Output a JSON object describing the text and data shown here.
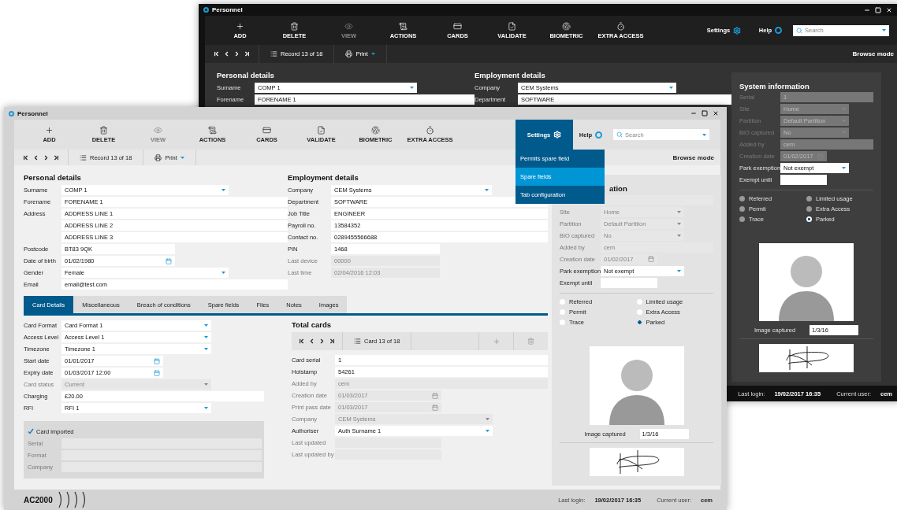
{
  "dark_window": {
    "title": "Personnel",
    "toolbar": [
      {
        "label": "ADD",
        "disabled": false
      },
      {
        "label": "DELETE",
        "disabled": false
      },
      {
        "label": "VIEW",
        "disabled": true
      },
      {
        "label": "ACTIONS",
        "disabled": false
      },
      {
        "label": "CARDS",
        "disabled": false
      },
      {
        "label": "VALIDATE",
        "disabled": false
      },
      {
        "label": "BIOMETRIC",
        "disabled": false
      },
      {
        "label": "EXTRA ACCESS",
        "disabled": false
      }
    ],
    "settings": {
      "label": "Settings",
      "expanded": false
    },
    "help": "Help",
    "search": {
      "placeholder": "Search"
    },
    "record": "Record 13 of 18",
    "print": "Print",
    "mode": "Browse mode",
    "personal": {
      "title": "Personal details",
      "rows": [
        {
          "label": "Surname",
          "value": "COMP 1",
          "kind": "select",
          "disabled": false
        },
        {
          "label": "Forename",
          "value": "FORENAME 1",
          "kind": "text",
          "disabled": false
        }
      ]
    },
    "employment": {
      "title": "Employment details",
      "rows": [
        {
          "label": "Company",
          "value": "CEM Systems",
          "kind": "select",
          "disabled": false
        },
        {
          "label": "Department",
          "value": "SOFTWARE",
          "kind": "text",
          "disabled": false
        }
      ]
    },
    "system": {
      "title": "System information",
      "rows": [
        {
          "label": "Serial",
          "value": "1",
          "kind": "text",
          "disabled": true
        },
        {
          "label": "Site",
          "value": "Home",
          "kind": "select",
          "disabled": true
        },
        {
          "label": "Partition",
          "value": "Default Partition",
          "kind": "select",
          "disabled": true
        },
        {
          "label": "BIO captured",
          "value": "No",
          "kind": "select",
          "disabled": true
        },
        {
          "label": "Added by",
          "value": "cem",
          "kind": "text",
          "disabled": true
        },
        {
          "label": "Creation date",
          "value": "01/02/2017",
          "kind": "date",
          "disabled": true
        },
        {
          "label": "Park exemption",
          "value": "Not exempt",
          "kind": "select",
          "disabled": false
        },
        {
          "label": "Exempt until",
          "kind": "short",
          "disabled": false
        }
      ],
      "flags": [
        {
          "label": "Referred",
          "selected": false
        },
        {
          "label": "Limited usage",
          "selected": false
        },
        {
          "label": "Permit",
          "selected": false
        },
        {
          "label": "Extra Access",
          "selected": false
        },
        {
          "label": "Trace",
          "selected": false
        },
        {
          "label": "Parked",
          "selected": true
        }
      ],
      "image_label": "Image captured",
      "image_date": "1/3/16"
    },
    "status": {
      "login_label": "Last login:",
      "login": "19/02/2017 16:35",
      "user_label": "Current user:",
      "user": "cem"
    }
  },
  "light_window": {
    "title": "Personnel",
    "toolbar": [
      {
        "label": "ADD",
        "disabled": false
      },
      {
        "label": "DELETE",
        "disabled": false
      },
      {
        "label": "VIEW",
        "disabled": true
      },
      {
        "label": "ACTIONS",
        "disabled": false
      },
      {
        "label": "CARDS",
        "disabled": false
      },
      {
        "label": "VALIDATE",
        "disabled": false
      },
      {
        "label": "BIOMETRIC",
        "disabled": false
      },
      {
        "label": "EXTRA ACCESS",
        "disabled": false
      }
    ],
    "settings": {
      "label": "Settings",
      "expanded": true,
      "menu": [
        {
          "label": "Permits spare field",
          "selected": false
        },
        {
          "label": "Spare fields",
          "selected": true
        },
        {
          "label": "Tab configuration",
          "selected": false
        }
      ]
    },
    "help": "Help",
    "search": {
      "placeholder": "Search"
    },
    "record": "Record 13 of 18",
    "print": "Print",
    "mode": "Browse mode",
    "personal": {
      "title": "Personal details",
      "rows": [
        {
          "label": "Surname",
          "value": "COMP 1",
          "kind": "select",
          "disabled": false
        },
        {
          "label": "Forename",
          "value": "FORENAME 1",
          "kind": "text",
          "disabled": false
        },
        {
          "label": "Address",
          "value": "ADDRESS LINE 1",
          "kind": "text",
          "disabled": false
        },
        {
          "value": "ADDRESS LINE 2",
          "kind": "text",
          "disabled": false
        },
        {
          "value": "ADDRESS LINE 3",
          "kind": "text",
          "disabled": false
        },
        {
          "label": "Postcode",
          "value": "BT83 9QK",
          "kind": "short",
          "disabled": false
        },
        {
          "label": "Date of birth",
          "value": "01/02/1980",
          "kind": "date",
          "disabled": false
        },
        {
          "label": "Gender",
          "value": "Female",
          "kind": "select",
          "disabled": false
        },
        {
          "label": "Email",
          "value": "email@test.com",
          "kind": "text",
          "disabled": false
        }
      ]
    },
    "employment": {
      "title": "Employment details",
      "rows": [
        {
          "label": "Company",
          "value": "CEM Systems",
          "kind": "select",
          "disabled": false
        },
        {
          "label": "Department",
          "value": "SOFTWARE",
          "kind": "text",
          "disabled": false
        },
        {
          "label": "Job Title",
          "value": "ENGINEER",
          "kind": "text",
          "disabled": false
        },
        {
          "label": "Payroll no.",
          "value": "13584352",
          "kind": "text",
          "disabled": false
        },
        {
          "label": "Contact no.",
          "value": "0289455566688",
          "kind": "text",
          "disabled": false
        },
        {
          "label": "PIN",
          "value": "1468",
          "kind": "short",
          "disabled": false
        },
        {
          "label": "Last device",
          "value": "00000",
          "kind": "short",
          "disabled": true
        },
        {
          "label": "Last time",
          "value": "02/04/2016 12:03",
          "kind": "short",
          "disabled": true
        }
      ]
    },
    "tabs": [
      {
        "label": "Card Details",
        "selected": true
      },
      {
        "label": "Miscellaneous",
        "selected": false
      },
      {
        "label": "Breach of conditions",
        "selected": false
      },
      {
        "label": "Spare fields",
        "selected": false
      },
      {
        "label": "Files",
        "selected": false
      },
      {
        "label": "Notes",
        "selected": false
      },
      {
        "label": "Images",
        "selected": false
      }
    ],
    "card_details": {
      "rows": [
        {
          "label": "Card Format",
          "value": "Card Format 1",
          "kind": "select",
          "disabled": false
        },
        {
          "label": "Access Level",
          "value": "Access Level 1",
          "kind": "select",
          "disabled": false
        },
        {
          "label": "Timezone",
          "value": "Timezone 1",
          "kind": "select",
          "disabled": false
        },
        {
          "label": "Start date",
          "value": "01/01/2017",
          "kind": "date",
          "disabled": false
        },
        {
          "label": "Expiry date",
          "value": "01/03/2017 12:00",
          "kind": "date",
          "disabled": false
        },
        {
          "label": "Card status",
          "value": "Current",
          "kind": "select",
          "disabled": true
        },
        {
          "label": "Charging",
          "value": "£20.00",
          "kind": "text",
          "disabled": false
        },
        {
          "label": "RFI",
          "value": "RFI 1",
          "kind": "select",
          "disabled": false
        }
      ],
      "imported": {
        "label": "Card imported",
        "checked": true,
        "rows": [
          {
            "label": "Serial",
            "kind": "text",
            "disabled": true
          },
          {
            "label": "Format",
            "kind": "text",
            "disabled": true
          },
          {
            "label": "Company",
            "kind": "text",
            "disabled": true
          }
        ]
      }
    },
    "total_cards": {
      "title": "Total cards",
      "record": "Card 13 of 18",
      "rows": [
        {
          "label": "Card serial",
          "value": "1",
          "kind": "text",
          "disabled": false
        },
        {
          "label": "Hotstamp",
          "value": "54261",
          "kind": "text",
          "disabled": false
        },
        {
          "label": "Added by",
          "value": "cem",
          "kind": "text",
          "disabled": true
        },
        {
          "label": "Creation date",
          "value": "01/03/2017",
          "kind": "date",
          "disabled": true
        },
        {
          "label": "Print pass date",
          "value": "01/03/2017",
          "kind": "date",
          "disabled": true
        },
        {
          "label": "Company",
          "value": "CEM Systems",
          "kind": "select",
          "disabled": true
        },
        {
          "label": "Authoriser",
          "value": "Auth Surname 1",
          "kind": "select",
          "disabled": false
        },
        {
          "label": "Last updated",
          "kind": "short",
          "disabled": true
        },
        {
          "label": "Last updated by",
          "kind": "short",
          "disabled": true
        }
      ]
    },
    "system": {
      "title": "ation",
      "rows": [
        {
          "kind": "text",
          "disabled": true
        },
        {
          "label": "Site",
          "value": "Home",
          "kind": "select",
          "disabled": true
        },
        {
          "label": "Partition",
          "value": "Default Partition",
          "kind": "select",
          "disabled": true
        },
        {
          "label": "BIO captured",
          "value": "No",
          "kind": "select",
          "disabled": true
        },
        {
          "label": "Added by",
          "value": "cem",
          "kind": "text",
          "disabled": true
        },
        {
          "label": "Creation date",
          "value": "01/02/2017",
          "kind": "date",
          "disabled": true
        },
        {
          "label": "Park exemption",
          "value": "Not exempt",
          "kind": "select",
          "disabled": false
        },
        {
          "label": "Exempt until",
          "kind": "short",
          "disabled": false
        }
      ],
      "flags": [
        {
          "label": "Referred",
          "selected": false
        },
        {
          "label": "Limited usage",
          "selected": false
        },
        {
          "label": "Permit",
          "selected": false
        },
        {
          "label": "Extra Access",
          "selected": false
        },
        {
          "label": "Trace",
          "selected": false
        },
        {
          "label": "Parked",
          "selected": true
        }
      ],
      "image_label": "Image captured",
      "image_date": "1/3/16"
    },
    "logo": "AC2000",
    "status": {
      "login_label": "Last login:",
      "login": "19/02/2017 16:35",
      "user_label": "Current user:",
      "user": "cem"
    }
  }
}
